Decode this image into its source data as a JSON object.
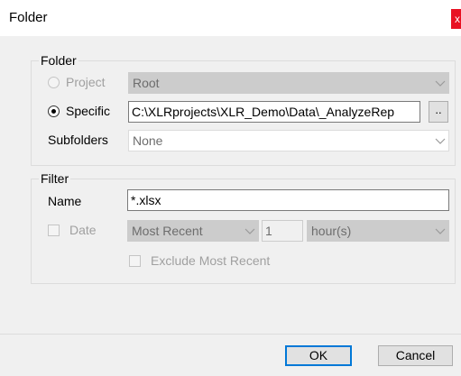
{
  "window": {
    "title": "Folder",
    "close_glyph": "x"
  },
  "folder_group": {
    "title": "Folder",
    "project_label": "Project",
    "project_value": "Root",
    "specific_label": "Specific",
    "specific_path": "C:\\XLRprojects\\XLR_Demo\\Data\\_AnalyzeRep",
    "browse_label": "..",
    "subfolders_label": "Subfolders",
    "subfolders_value": "None"
  },
  "filter_group": {
    "title": "Filter",
    "name_label": "Name",
    "name_value": "*.xlsx",
    "date_label": "Date",
    "date_mode": "Most Recent",
    "date_count": "1",
    "date_unit": "hour(s)",
    "exclude_label": "Exclude Most Recent"
  },
  "buttons": {
    "ok": "OK",
    "cancel": "Cancel"
  },
  "colors": {
    "close": "#e81123",
    "default_border": "#0078d7"
  }
}
